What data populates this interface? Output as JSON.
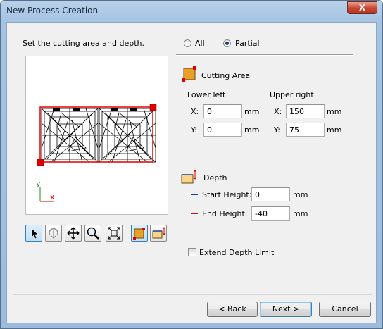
{
  "window": {
    "title": "New Process Creation",
    "close_label": "X"
  },
  "instruction": "Set the cutting area and depth.",
  "area_mode": {
    "options": [
      "All",
      "Partial"
    ],
    "selected": "Partial"
  },
  "cutting_area": {
    "title": "Cutting Area",
    "lower_left": {
      "heading": "Lower left",
      "x_label": "X:",
      "x_value": "0",
      "y_label": "Y:",
      "y_value": "0",
      "unit": "mm"
    },
    "upper_right": {
      "heading": "Upper right",
      "x_label": "X:",
      "x_value": "150",
      "y_label": "Y:",
      "y_value": "75",
      "unit": "mm"
    }
  },
  "depth": {
    "title": "Depth",
    "start_label": "Start Height:",
    "start_value": "0",
    "start_color": "#1f3fa0",
    "end_label": "End Height:",
    "end_value": "-40",
    "end_color": "#d01010",
    "unit": "mm"
  },
  "extend_depth_limit": {
    "label": "Extend Depth Limit",
    "checked": false
  },
  "preview": {
    "axis_y": "y",
    "axis_x": "x",
    "selection_color": "#e00000"
  },
  "toolbar": {
    "tools": [
      "select-icon",
      "rotate-icon",
      "pan-icon",
      "zoom-icon",
      "fit-icon",
      "cutting-area-icon",
      "depth-icon"
    ],
    "active": [
      "select-icon",
      "cutting-area-icon"
    ]
  },
  "buttons": {
    "back": "< Back",
    "next": "Next >",
    "cancel": "Cancel"
  }
}
